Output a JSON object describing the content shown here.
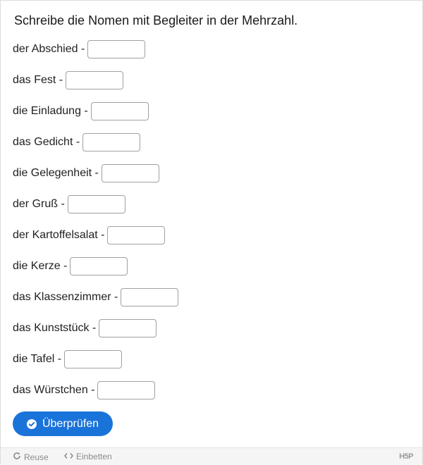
{
  "task": {
    "title": "Schreibe die Nomen mit Begleiter in der Mehrzahl."
  },
  "items": [
    {
      "label": "der Abschied -",
      "value": ""
    },
    {
      "label": "das Fest -",
      "value": ""
    },
    {
      "label": "die Einladung -",
      "value": ""
    },
    {
      "label": "das Gedicht -",
      "value": ""
    },
    {
      "label": "die Gelegenheit -",
      "value": ""
    },
    {
      "label": "der Gruß -",
      "value": ""
    },
    {
      "label": "der Kartoffelsalat -",
      "value": ""
    },
    {
      "label": "die Kerze -",
      "value": ""
    },
    {
      "label": "das Klassenzimmer -",
      "value": ""
    },
    {
      "label": "das Kunststück -",
      "value": ""
    },
    {
      "label": "die Tafel -",
      "value": ""
    },
    {
      "label": "das Würstchen -",
      "value": ""
    }
  ],
  "check_button": {
    "label": "Überprüfen",
    "icon": "check-circle-icon"
  },
  "footer": {
    "reuse_label": "Reuse",
    "reuse_icon": "refresh-icon",
    "embed_label": "Einbetten",
    "embed_icon": "code-icon",
    "logo": "H5P"
  },
  "colors": {
    "accent": "#1a73d9",
    "footer_bg": "#f5f5f5",
    "input_border": "#a0a0a0"
  }
}
